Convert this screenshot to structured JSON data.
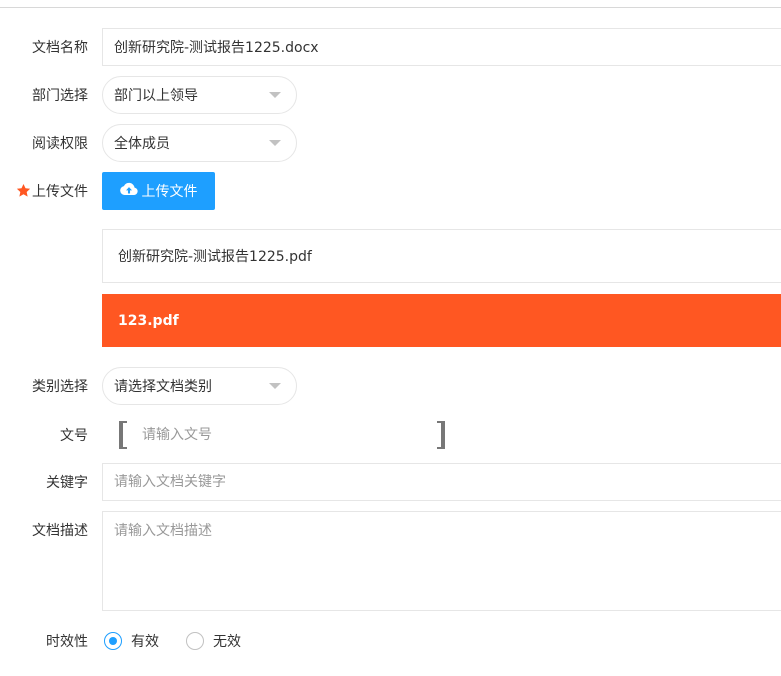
{
  "form": {
    "doc_name": {
      "label": "文档名称",
      "value": "创新研究院-测试报告1225.docx"
    },
    "department": {
      "label": "部门选择",
      "selected": "部门以上领导"
    },
    "read_permission": {
      "label": "阅读权限",
      "selected": "全体成员"
    },
    "upload": {
      "label": "上传文件",
      "required": true,
      "button_label": "上传文件",
      "files": [
        "创新研究院-测试报告1225.pdf",
        "123.pdf"
      ],
      "active_file": "123.pdf"
    },
    "category": {
      "label": "类别选择",
      "selected": "请选择文档类别"
    },
    "doc_number": {
      "label": "文号",
      "placeholder": "请输入文号"
    },
    "keywords": {
      "label": "关键字",
      "placeholder": "请输入文档关键字"
    },
    "description": {
      "label": "文档描述",
      "placeholder": "请输入文档描述"
    },
    "validity": {
      "label": "时效性",
      "options": [
        "有效",
        "无效"
      ],
      "selected": "有效"
    }
  },
  "colors": {
    "primary": "#1e9fff",
    "accent": "#ff5722",
    "border": "#e6e6e6",
    "placeholder": "#999999"
  },
  "icons": {
    "required": "star-icon",
    "upload": "cloud-upload-icon",
    "dropdown": "caret-down-icon"
  }
}
